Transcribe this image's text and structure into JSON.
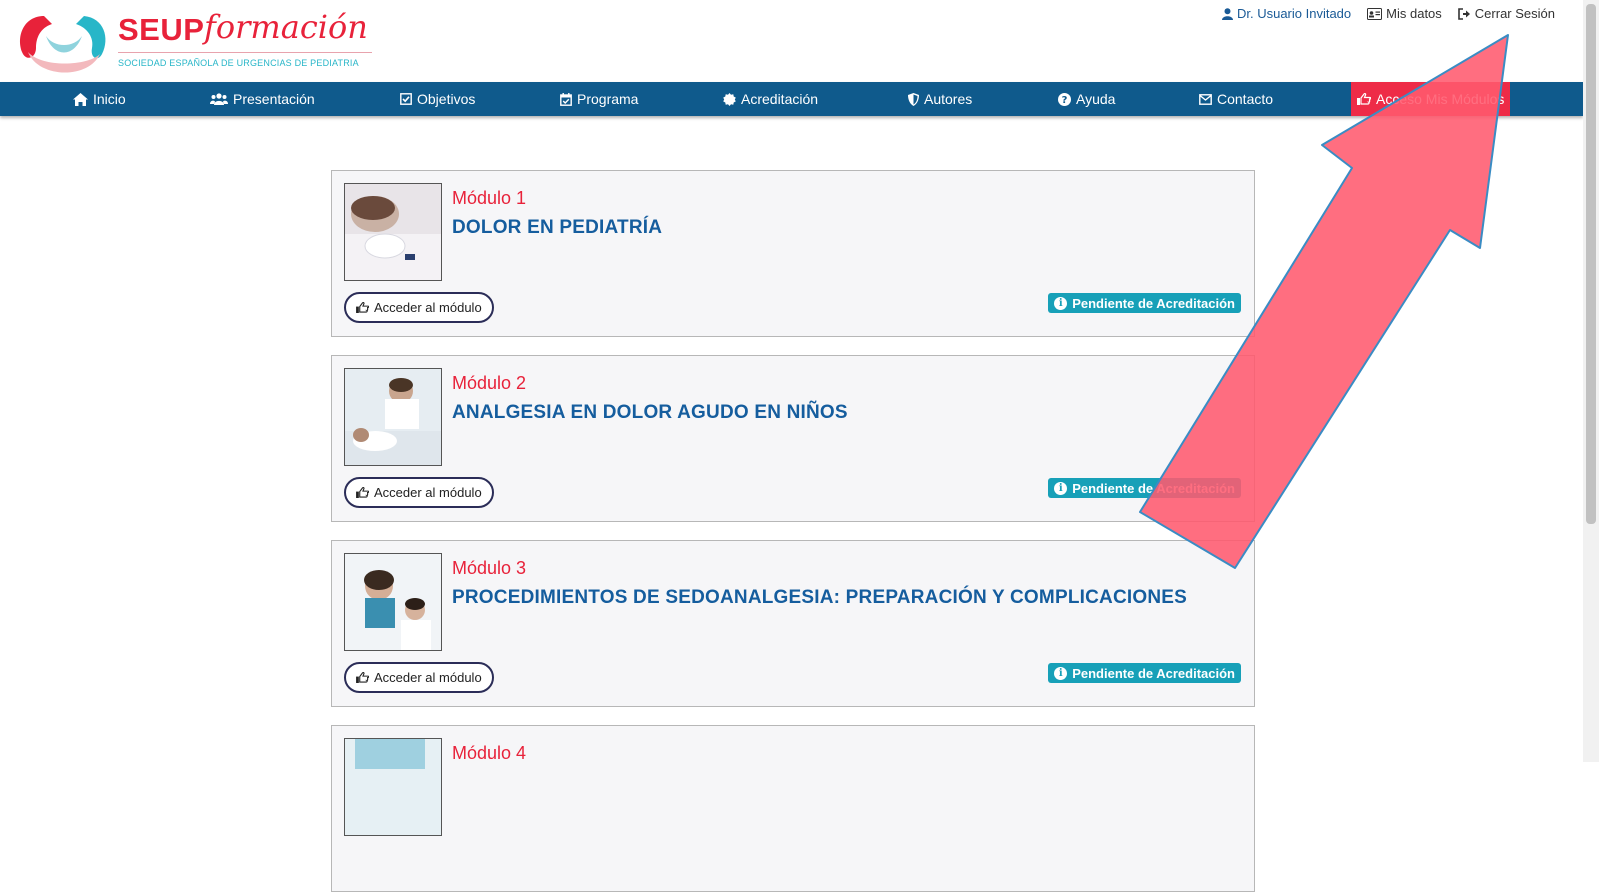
{
  "header": {
    "brand": "SEUP",
    "brand_script": "formación",
    "subtitle": "SOCIEDAD ESPAÑOLA DE URGENCIAS DE PEDIATRIA",
    "user_link": "Dr. Usuario Invitado",
    "my_data_link": "Mis datos",
    "logout_link": "Cerrar Sesión"
  },
  "nav": {
    "items": [
      {
        "label": "Inicio",
        "icon": "home-icon"
      },
      {
        "label": "Presentación",
        "icon": "users-icon"
      },
      {
        "label": "Objetivos",
        "icon": "check-square-icon"
      },
      {
        "label": "Programa",
        "icon": "calendar-check-icon"
      },
      {
        "label": "Acreditación",
        "icon": "certificate-icon"
      },
      {
        "label": "Autores",
        "icon": "shield-icon"
      },
      {
        "label": "Ayuda",
        "icon": "question-circle-icon"
      },
      {
        "label": "Contacto",
        "icon": "envelope-icon"
      },
      {
        "label": "Acceso Mis Módulos",
        "icon": "hand-pointer-icon"
      }
    ]
  },
  "modules": [
    {
      "number": "Módulo 1",
      "title": "DOLOR EN PEDIATRÍA",
      "button": "Acceder al módulo",
      "status": "Pendiente de Acreditación"
    },
    {
      "number": "Módulo 2",
      "title": "ANALGESIA EN DOLOR AGUDO EN NIÑOS",
      "button": "Acceder al módulo",
      "status": "Pendiente de Acreditación"
    },
    {
      "number": "Módulo 3",
      "title": "PROCEDIMIENTOS DE SEDOANALGESIA: PREPARACIÓN Y COMPLICACIONES",
      "button": "Acceder al módulo",
      "status": "Pendiente de Acreditación"
    },
    {
      "number": "Módulo 4",
      "title": "",
      "button": "",
      "status": ""
    }
  ],
  "colors": {
    "brand_red": "#e8223a",
    "nav_blue": "#0f5a8c",
    "title_blue": "#155d9e",
    "badge_teal": "#17a0b8",
    "arrow_fill": "#ff5a6e"
  }
}
